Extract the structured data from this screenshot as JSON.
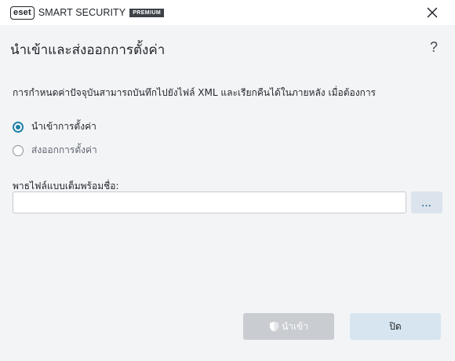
{
  "window": {
    "brand": "eset",
    "product": "SMART SECURITY",
    "edition": "PREMIUM"
  },
  "dialog": {
    "title": "นำเข้าและส่งออกการตั้งค่า",
    "help_glyph": "?",
    "description": "การกำหนดค่าปัจจุบันสามารถบันทึกไปยังไฟล์ XML และเรียกคืนได้ในภายหลัง เมื่อต้องการ"
  },
  "options": {
    "import_label": "นำเข้าการตั้งค่า",
    "export_label": "ส่งออกการตั้งค่า",
    "selected": "import"
  },
  "path": {
    "label": "พาธไฟล์แบบเต็มพร้อมชื่อ:",
    "value": "",
    "browse_label": "..."
  },
  "buttons": {
    "import_label": "นำเข้า",
    "close_label": "ปิด"
  },
  "colors": {
    "accent": "#1d7fa8",
    "background": "#f3f4f6",
    "disabled_button": "#c9ccd1",
    "secondary_button": "#d6e5ef"
  }
}
